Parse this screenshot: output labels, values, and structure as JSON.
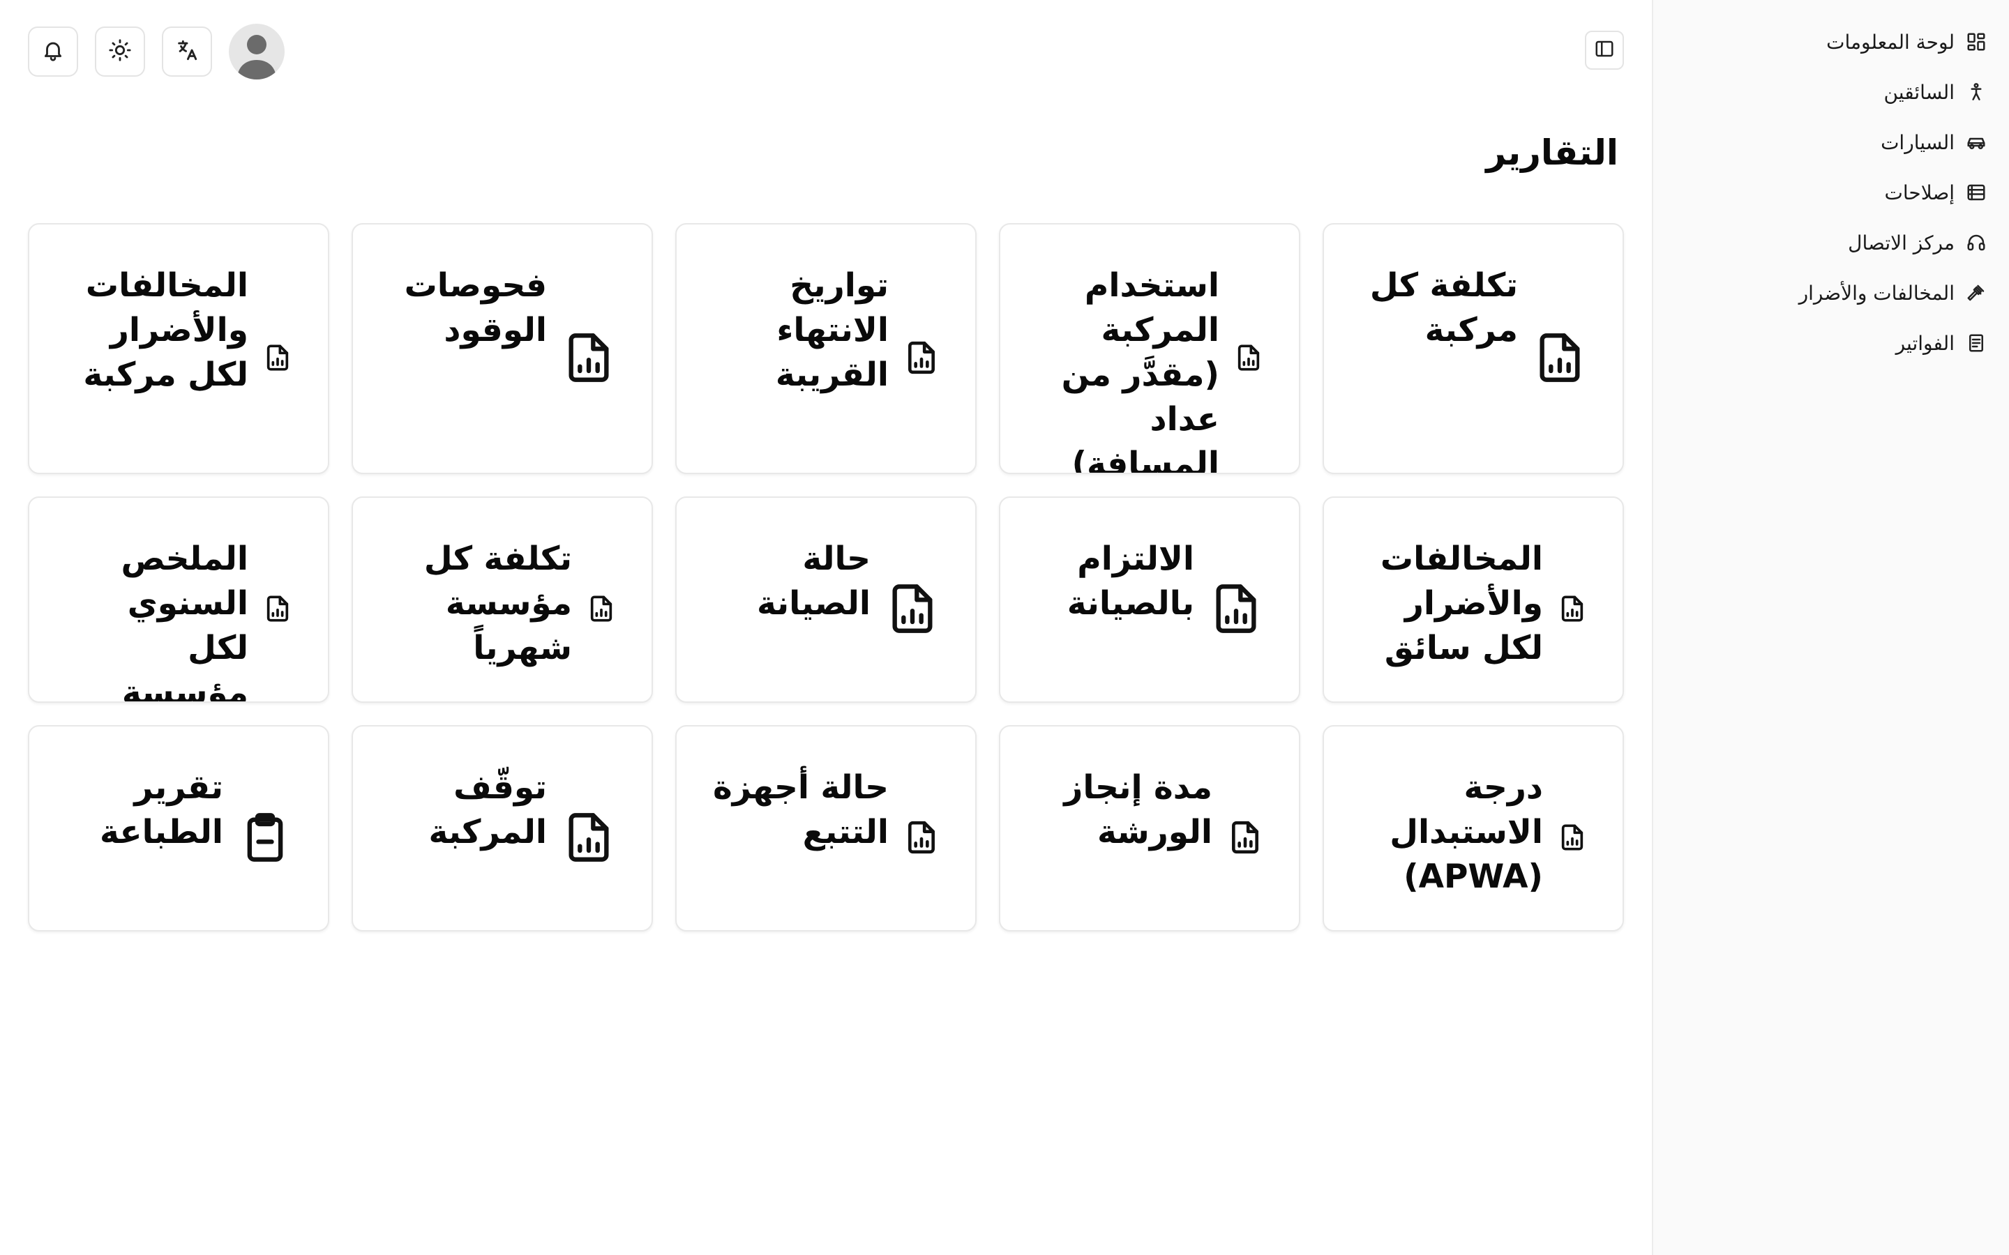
{
  "sidebar": {
    "items": [
      {
        "label": "لوحة المعلومات",
        "icon": "dashboard-icon"
      },
      {
        "label": "السائقين",
        "icon": "person-icon"
      },
      {
        "label": "السيارات",
        "icon": "car-icon"
      },
      {
        "label": "إصلاحات",
        "icon": "repair-icon"
      },
      {
        "label": "مركز الاتصال",
        "icon": "headset-icon"
      },
      {
        "label": "المخالفات والأضرار",
        "icon": "gavel-icon"
      },
      {
        "label": "الفواتير",
        "icon": "invoice-icon"
      }
    ]
  },
  "header": {
    "sidebar_toggle_icon": "sidebar-toggle-icon",
    "actions": [
      "bell-icon",
      "sun-icon",
      "translate-icon",
      "avatar-icon"
    ]
  },
  "page": {
    "title": "التقارير"
  },
  "reports": [
    {
      "title": "تكلفة كل مركبة",
      "icon": "file-chart-icon"
    },
    {
      "title": "استخدام المركبة (مقدَّر من عداد المسافة)",
      "icon": "file-chart-icon"
    },
    {
      "title": "تواريخ الانتهاء القريبة",
      "icon": "file-chart-icon"
    },
    {
      "title": "فحوصات الوقود",
      "icon": "file-chart-icon"
    },
    {
      "title": "المخالفات والأضرار لكل مركبة",
      "icon": "file-chart-icon"
    },
    {
      "title": "المخالفات والأضرار لكل سائق",
      "icon": "file-chart-icon"
    },
    {
      "title": "الالتزام بالصيانة",
      "icon": "file-chart-icon"
    },
    {
      "title": "حالة الصيانة",
      "icon": "file-chart-icon"
    },
    {
      "title": "تكلفة كل مؤسسة شهرياً",
      "icon": "file-chart-icon"
    },
    {
      "title": "الملخص السنوي لكل مؤسسة",
      "icon": "file-chart-icon"
    },
    {
      "title": "درجة الاستبدال (APWA)",
      "icon": "file-chart-icon"
    },
    {
      "title": "مدة إنجاز الورشة",
      "icon": "file-chart-icon"
    },
    {
      "title": "حالة أجهزة التتبع",
      "icon": "file-chart-icon"
    },
    {
      "title": "توقّف المركبة",
      "icon": "file-chart-icon"
    },
    {
      "title": "تقرير الطباعة",
      "icon": "clipboard-icon"
    }
  ]
}
